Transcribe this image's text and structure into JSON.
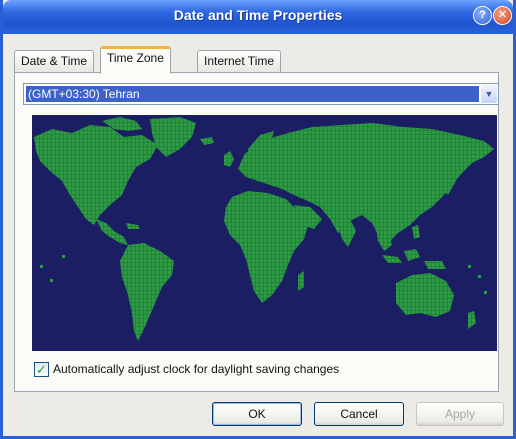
{
  "window": {
    "title": "Date and Time Properties",
    "help_glyph": "?",
    "close_glyph": "✕"
  },
  "tabs": [
    {
      "label": "Date & Time",
      "active": false
    },
    {
      "label": "Time Zone",
      "active": true
    },
    {
      "label": "Internet Time",
      "active": false
    }
  ],
  "timezone": {
    "selected": "(GMT+03:30) Tehran",
    "dropdown_icon": "chevron-down-icon"
  },
  "map": {
    "ocean_color": "#1b1e62",
    "land_color": "#2f9b46"
  },
  "dst": {
    "label": "Automatically adjust clock for daylight saving changes",
    "checked": true
  },
  "buttons": {
    "ok": "OK",
    "cancel": "Cancel",
    "apply": "Apply"
  },
  "colors": {
    "titlebar": "#2f68e0",
    "selection": "#3b62c6",
    "active_tab_accent": "#f1b63b"
  }
}
